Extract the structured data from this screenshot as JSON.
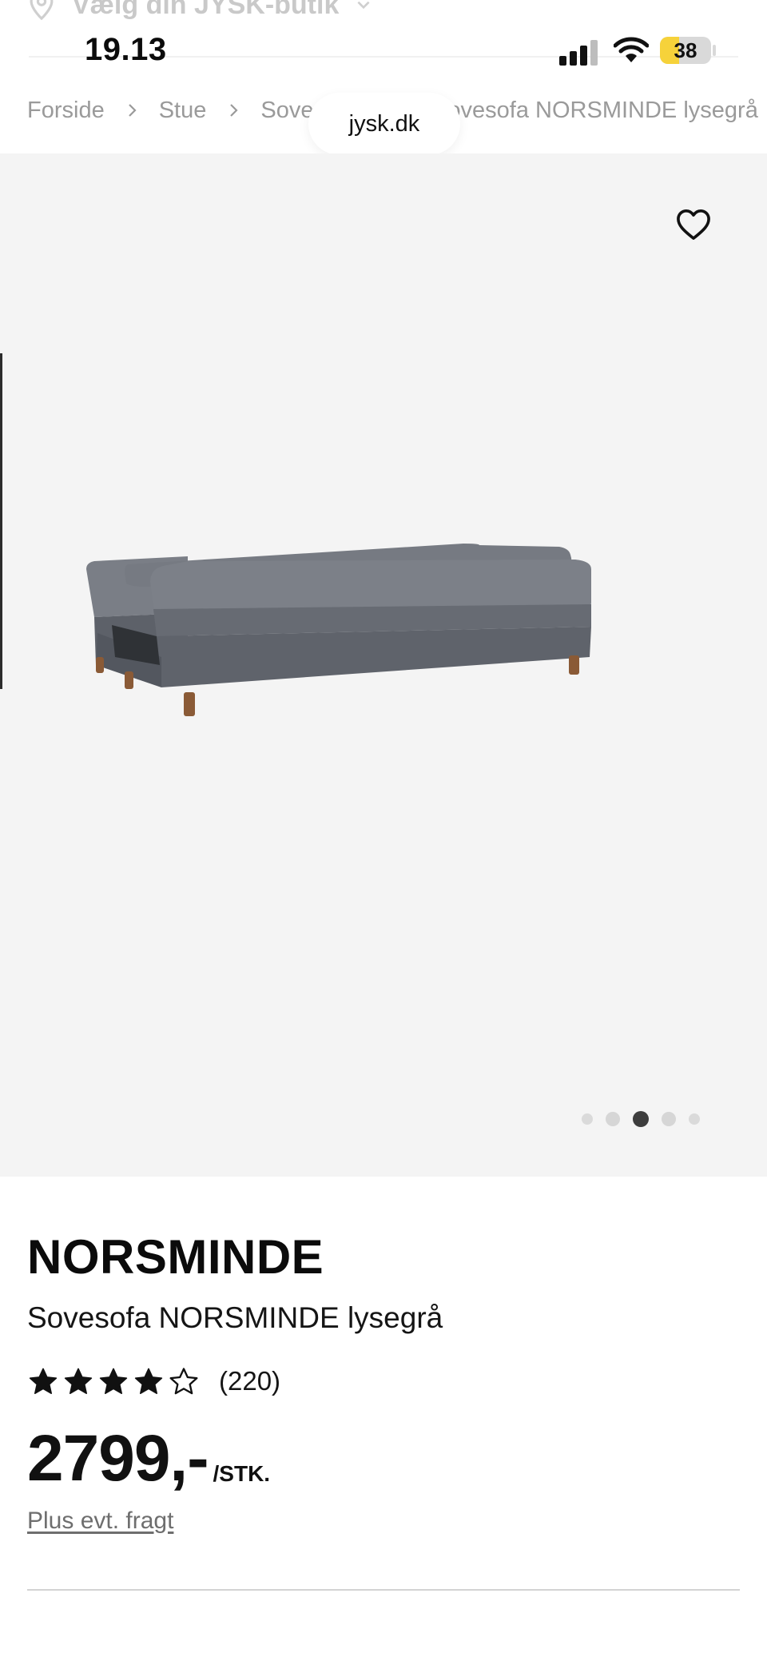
{
  "store_selector": {
    "label": "Vælg din JYSK-butik",
    "icon": "location-pin-icon"
  },
  "status_bar": {
    "time": "19.13",
    "battery_percent": "38",
    "battery_level": 0.38,
    "icons": [
      "cellular-signal-icon",
      "wifi-icon",
      "battery-icon"
    ]
  },
  "breadcrumb": {
    "items": [
      "Forside",
      "Stue",
      "Sovesofaer",
      "Sovesofa NORSMINDE lysegrå"
    ],
    "separator_icon": "chevron-right-icon"
  },
  "browser": {
    "url": "jysk.dk"
  },
  "gallery": {
    "image_alt": "Sovesofa NORSMINDE lysegrå",
    "favorite_icon": "heart-icon",
    "total_images": 5,
    "active_index": 3
  },
  "product": {
    "brand": "NORSMINDE",
    "name": "Sovesofa NORSMINDE lysegrå",
    "rating": 4,
    "rating_max": 5,
    "review_count": "(220)",
    "price": "2799,-",
    "unit": "/STK.",
    "freight_link": "Plus evt. fragt"
  },
  "colors": {
    "image_background": "#f4f4f4",
    "sofa_fabric": "#6f737b",
    "battery_fill": "#f6d23a"
  }
}
